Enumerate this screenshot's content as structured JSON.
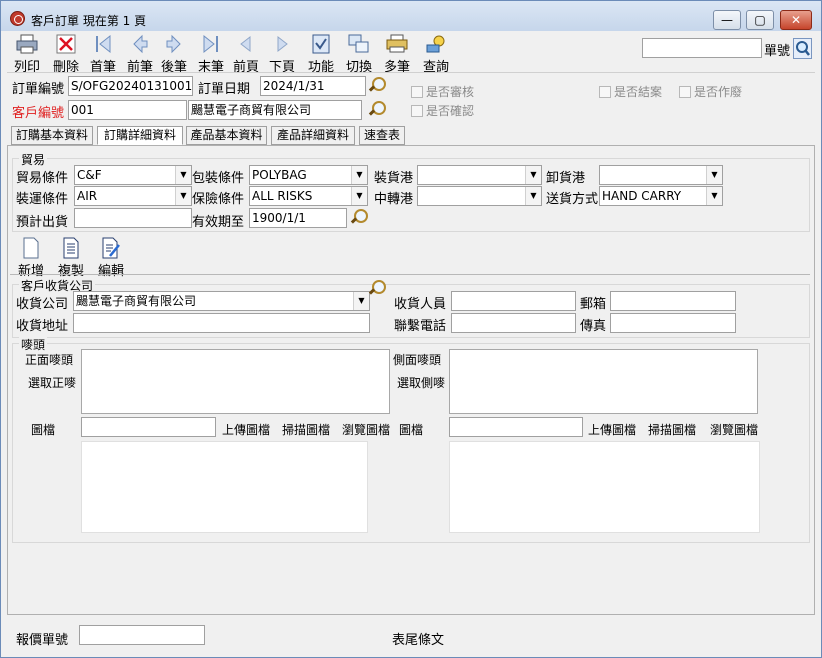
{
  "window": {
    "title": "客戶訂單  現在第 1 頁",
    "minimize": "—",
    "maximize": "▢",
    "close": "✕"
  },
  "toolbar": {
    "items": [
      {
        "label": "列印",
        "icon": "printer-icon"
      },
      {
        "label": "刪除",
        "icon": "delete-icon"
      },
      {
        "label": "首筆",
        "icon": "first-record-icon"
      },
      {
        "label": "前筆",
        "icon": "prev-record-icon"
      },
      {
        "label": "後筆",
        "icon": "next-record-icon"
      },
      {
        "label": "末筆",
        "icon": "last-record-icon"
      },
      {
        "label": "前頁",
        "icon": "prev-page-icon"
      },
      {
        "label": "下頁",
        "icon": "next-page-icon"
      },
      {
        "label": "功能",
        "icon": "function-icon"
      },
      {
        "label": "切換",
        "icon": "switch-icon"
      },
      {
        "label": "多筆",
        "icon": "multi-record-icon"
      },
      {
        "label": "查詢",
        "icon": "query-icon"
      }
    ],
    "search_value": "",
    "search_label": "單號"
  },
  "header": {
    "order_no_label": "訂單編號",
    "order_no": "S/OFG20240131001",
    "order_date_label": "訂單日期",
    "order_date": "2024/1/31",
    "customer_no_label": "客戶編號",
    "customer_no": "001",
    "customer_name": "颺慧電子商貿有限公司",
    "chk_reviewed": "是否審核",
    "chk_confirmed": "是否確認",
    "chk_closed": "是否結案",
    "chk_voided": "是否作廢"
  },
  "tabs": [
    "訂購基本資料",
    "訂購詳細資料",
    "產品基本資料",
    "產品詳細資料",
    "速查表"
  ],
  "trade": {
    "group_title": "貿易",
    "trade_terms_label": "貿易條件",
    "trade_terms": "C&F",
    "packing_label": "包裝條件",
    "packing": "POLYBAG",
    "loading_port_label": "裝貨港",
    "loading_port": "",
    "unloading_port_label": "卸貨港",
    "unloading_port": "",
    "shipping_label": "裝運條件",
    "shipping": "AIR",
    "insurance_label": "保險條件",
    "insurance": "ALL RISKS",
    "transit_port_label": "中轉港",
    "transit_port": "",
    "delivery_label": "送貨方式",
    "delivery": "HAND CARRY",
    "est_ship_label": "預計出貨",
    "est_ship": "",
    "valid_until_label": "有效期至",
    "valid_until": "1900/1/1"
  },
  "actions": [
    {
      "label": "新增",
      "icon": "new-doc-icon"
    },
    {
      "label": "複製",
      "icon": "copy-doc-icon"
    },
    {
      "label": "編輯",
      "icon": "edit-doc-icon"
    }
  ],
  "receiver": {
    "group_title": "客戶收貨公司",
    "company_label": "收貨公司",
    "company": "颺慧電子商貿有限公司",
    "address_label": "收貨地址",
    "address": "",
    "person_label": "收貨人員",
    "person": "",
    "mail_label": "郵箱",
    "mail": "",
    "phone_label": "聯繫電話",
    "phone": "",
    "fax_label": "傳真",
    "fax": ""
  },
  "mark": {
    "group_title": "嘜頭",
    "front_label": "正面嘜頭",
    "select_front": "選取正嘜",
    "side_label": "側面嘜頭",
    "select_side": "選取側嘜",
    "image_label": "圖檔",
    "upload": "上傳圖檔",
    "scan": "掃描圖檔",
    "browse": "瀏覽圖檔"
  },
  "footer": {
    "quote_no_label": "報價單號",
    "quote_no": "",
    "footer_text_label": "表尾條文"
  }
}
